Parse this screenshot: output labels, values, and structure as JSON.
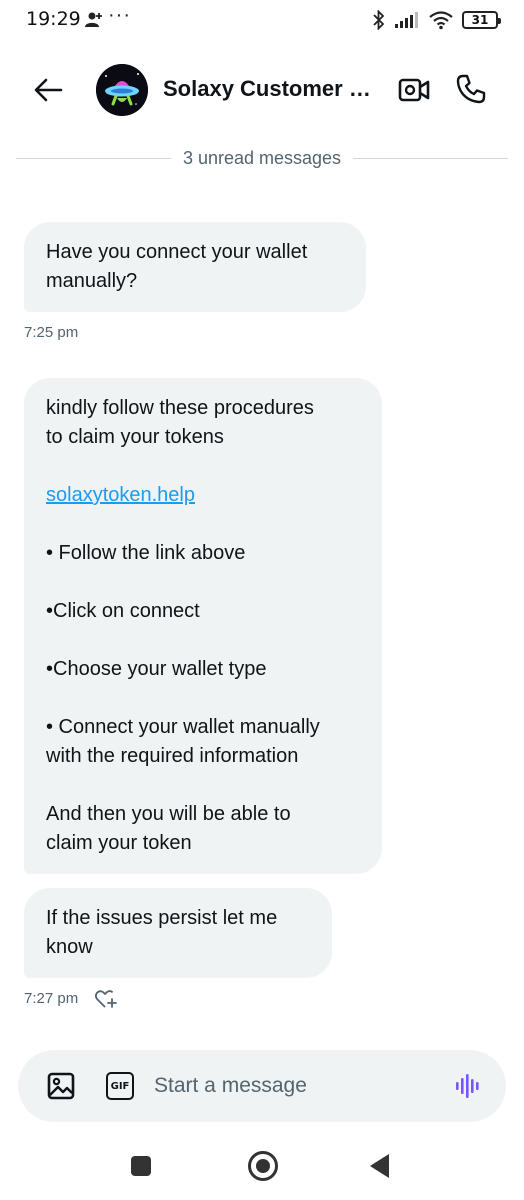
{
  "status_bar": {
    "time": "19:29",
    "dots": "···",
    "battery": "31"
  },
  "header": {
    "title": "Solaxy Customer Support",
    "back_icon": "arrow-left-icon",
    "video_icon": "video-call-icon",
    "call_icon": "phone-icon"
  },
  "divider": {
    "text": "3 unread messages"
  },
  "messages": [
    {
      "lines": [
        "Have you connect your wallet",
        "manually?"
      ],
      "time": "7:25 pm"
    },
    {
      "intro": [
        "kindly follow these procedures",
        "to claim your tokens"
      ],
      "link": "solaxytoken.help",
      "step1": "• Follow the link above",
      "step2": "•Click on connect",
      "step3": "•Choose your wallet type",
      "step4": [
        "• Connect your wallet manually",
        "with the required information"
      ],
      "outro": [
        "And then you will be able to",
        "claim your token"
      ]
    },
    {
      "lines": [
        "If the issues persist let me",
        "know"
      ],
      "time": "7:27 pm"
    }
  ],
  "composer": {
    "placeholder": "Start a message",
    "gif_label": "GIF"
  },
  "colors": {
    "bubble": "#eff3f4",
    "link": "#1d9bf0",
    "voice": "#7856ff",
    "muted": "#536471"
  }
}
